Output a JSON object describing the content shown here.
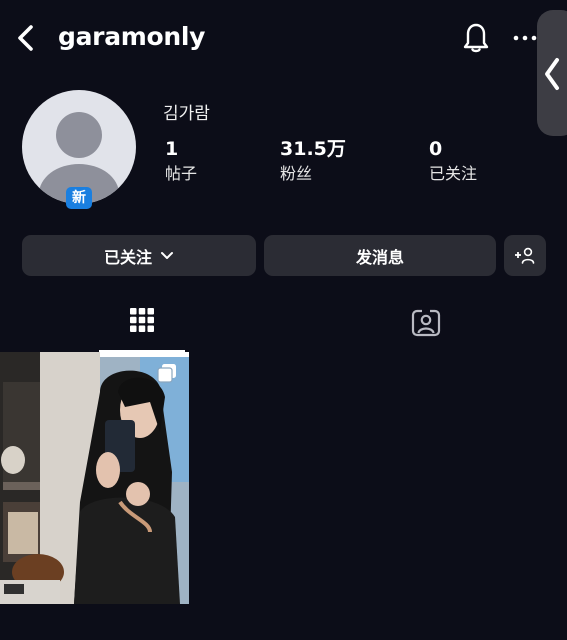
{
  "header": {
    "username": "garamonly",
    "icons": [
      "back-arrow-icon",
      "bell-icon",
      "more-icon",
      "side-handle-chevron-icon"
    ]
  },
  "profile": {
    "display_name": "김가람",
    "avatar_badge": "新",
    "stats": [
      {
        "value": "1",
        "label": "帖子"
      },
      {
        "value": "31.5万",
        "label": "粉丝"
      },
      {
        "value": "0",
        "label": "已关注"
      }
    ]
  },
  "actions": {
    "follow_label": "已关注",
    "message_label": "发消息"
  },
  "tabs": {
    "active": "posts-grid",
    "items": [
      "grid-icon",
      "tagged-icon"
    ]
  },
  "posts": [
    {
      "type": "photo",
      "multi_image": true
    }
  ],
  "colors": {
    "background": "#0c0d18",
    "button": "#2b2c34",
    "badge": "#1a7fe0",
    "text": "#ffffff"
  }
}
